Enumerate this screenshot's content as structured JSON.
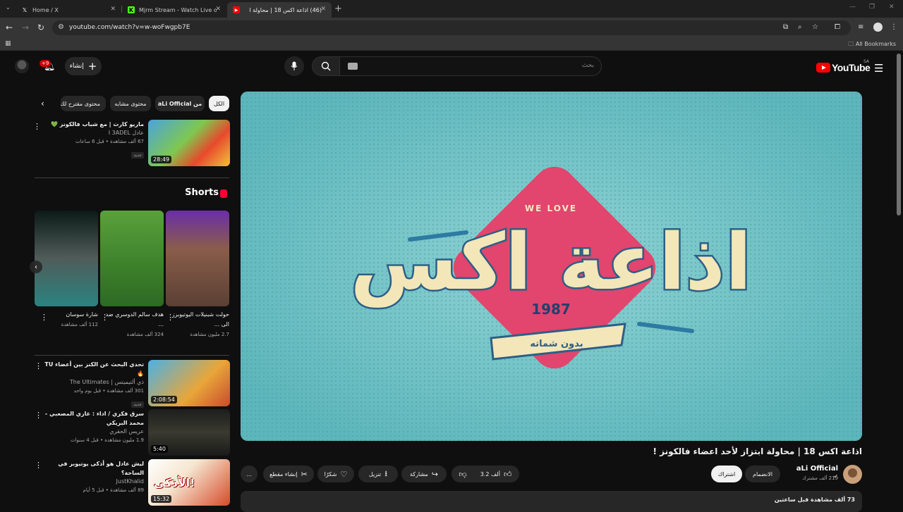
{
  "browser": {
    "tabs": [
      {
        "title": "Home / X",
        "icon": "x-logo-icon"
      },
      {
        "title": "Mjrm Stream - Watch Live on K",
        "icon": "kick-logo-icon"
      },
      {
        "title": "(46) اذاعة اكس 18 | محاولة ا",
        "icon": "youtube-logo-icon"
      }
    ],
    "url": "youtube.com/watch?v=w-woFwgpb7E",
    "all_bookmarks": "All Bookmarks"
  },
  "header": {
    "logo_text": "YouTube",
    "region": "SA",
    "search_placeholder": "بحث",
    "create_label": "إنشاء",
    "notifications": "+9"
  },
  "chips": [
    "الكل",
    "من aLi Official",
    "محتوى مشابه",
    "محتوى مقترح لك"
  ],
  "related_top": {
    "title": "ماريو كارت | مع شباب فالكونز 💚",
    "channel": "عادل I 3ADEL",
    "stats": "67 ألف مشاهدة • قبل 6 ساعات",
    "badge": "جديد",
    "duration": "28:49"
  },
  "shorts": {
    "heading": "Shorts",
    "items": [
      {
        "title": "حولت شبنيلات اليوتيوبرز الى ...",
        "views": "2.7 مليون مشاهدة"
      },
      {
        "title": "هدف سالم الدوسري ضد ...",
        "views": "324 ألف مشاهدة"
      },
      {
        "title": "شارة سوسان",
        "views": "112 ألف مشاهدة"
      }
    ]
  },
  "related": [
    {
      "title": "تحدي البحث عن الكنز بين أعضاء TU 🔥",
      "channel": "ذي ألتيميتس | The Ultimates",
      "stats": "301 ألف مشاهدة • قبل يوم واحد",
      "badge": "جديد",
      "duration": "2:08:54"
    },
    {
      "title": "سرق فكري / اداء : غازي المصعبي - محمد البريكي",
      "channel": "عريس الحقري",
      "stats": "1.9 مليون مشاهدة • قبل 4 سنوات",
      "badge": "",
      "duration": "5:40"
    },
    {
      "title": "ليش عادل هو أذكى يوتيوبر في الساحة؟",
      "channel": "JustKhalid",
      "stats": "89 ألف مشاهدة • قبل 5 أيام",
      "badge": "",
      "duration": "15:32",
      "thumb_text": "الأذكى!"
    }
  ],
  "video": {
    "title": "اذاعة اكس 18 | محاولة ابتزاز لأحد اعضاء فالكونز !",
    "art_small": "WE LOVE",
    "art_title": "اذاعة اكس",
    "art_year": "1987",
    "art_ribbon": "بدون شماته"
  },
  "channel": {
    "name": "aLi Official",
    "subs": "219 ألف مشترك",
    "join_label": "الانضمام",
    "subscribe_label": "اشتراك"
  },
  "actions": {
    "likes": "3.2 ألف",
    "share": "مشاركة",
    "download": "تنزيل",
    "thanks": "شكرًا",
    "clip": "إنشاء مقطع",
    "more": "..."
  },
  "description": {
    "line": "73 ألف مشاهدة  قبل ساعتين"
  },
  "colors": {
    "accent": "#ff0000",
    "bg": "#0f0f0f",
    "surface": "#272727"
  }
}
